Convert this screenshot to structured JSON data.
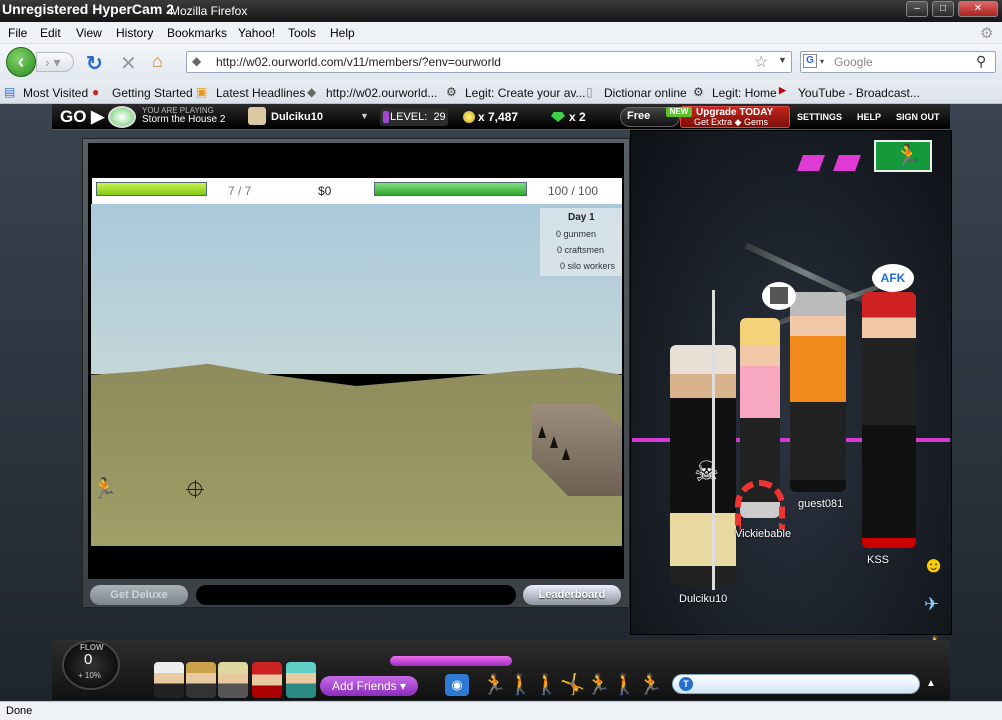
{
  "window": {
    "recorder": "Unregistered HyperCam 2",
    "title": "Mozilla Firefox"
  },
  "menu": [
    "File",
    "Edit",
    "View",
    "History",
    "Bookmarks",
    "Yahoo!",
    "Tools",
    "Help"
  ],
  "nav": {
    "url": "http://w02.ourworld.com/v11/members/?env=ourworld",
    "search_placeholder": "Google"
  },
  "bookmarks": [
    "Most Visited",
    "Getting Started",
    "Latest Headlines",
    "http://w02.ourworld...",
    "Legit: Create your av...",
    "Dictionar online",
    "Legit: Home",
    "YouTube - Broadcast..."
  ],
  "ow": {
    "go": "GO",
    "you_are_playing": "YOU ARE PLAYING",
    "game_name": "Storm the House 2",
    "username": "Dulciku10",
    "level_label": "LEVEL:",
    "level": "29",
    "coins": "x 7,487",
    "gems": "x 2",
    "free": "Free",
    "new": "NEW",
    "upgrade": "Upgrade TODAY",
    "get_extra": "Get Extra",
    "gems_word": "Gems",
    "settings": "SETTINGS",
    "help": "HELP",
    "signout": "SIGN OUT"
  },
  "game": {
    "ammo": "7 / 7",
    "money": "$0",
    "health": "100 / 100",
    "day": "Day 1",
    "gunmen": "0 gunmen",
    "craftsmen": "0 craftsmen",
    "silo": "0 silo workers",
    "deluxe": "Get Deluxe",
    "leaderboard": "Leaderboard"
  },
  "room": {
    "afk": "AFK",
    "names": [
      "Dulciku10",
      "Vickiebable",
      "guest081",
      "KSS"
    ]
  },
  "bottom": {
    "flow_label": "FLOW",
    "flow_value": "0",
    "flow_pct": "+ 10%",
    "add_friends": "Add Friends",
    "chat_icon": "T"
  },
  "status": "Done",
  "colors": {
    "accent_green": "#2b8a1f",
    "upgrade_red": "#c4251d",
    "purple": "#9b2ec0"
  }
}
